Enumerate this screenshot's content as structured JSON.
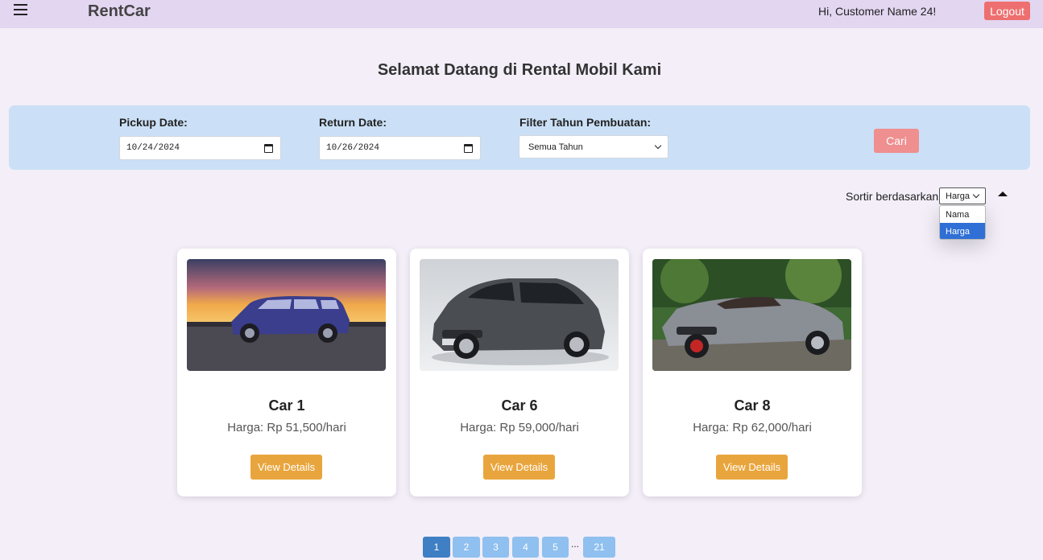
{
  "navbar": {
    "menu_icon": "hamburger-menu-icon",
    "brand": "RentCar",
    "greeting": "Hi, Customer Name 24!",
    "logout_label": "Logout"
  },
  "page_title": "Selamat Datang di Rental Mobil Kami",
  "search": {
    "pickup_label": "Pickup Date:",
    "pickup_value": "10/24/2024",
    "return_label": "Return Date:",
    "return_value": "10/26/2024",
    "year_label": "Filter Tahun Pembuatan:",
    "year_value": "Semua Tahun",
    "search_label": "Cari",
    "date_icon": "calendar-icon"
  },
  "sort": {
    "label": "Sortir berdasarkan:",
    "value": "Harga",
    "options": [
      "Nama",
      "Harga"
    ],
    "selected_option": "Harga",
    "direction_icon": "sort-ascending-icon"
  },
  "cars": [
    {
      "name": "Car 1",
      "price": "Harga: Rp 51,500/hari",
      "button": "View Details"
    },
    {
      "name": "Car 6",
      "price": "Harga: Rp 59,000/hari",
      "button": "View Details"
    },
    {
      "name": "Car 8",
      "price": "Harga: Rp 62,000/hari",
      "button": "View Details"
    }
  ],
  "pagination": {
    "pages": [
      "1",
      "2",
      "3",
      "4",
      "5"
    ],
    "ellipsis": "...",
    "last": "21",
    "current": "1"
  },
  "colors": {
    "navbar_bg": "#e3d6f1",
    "page_bg": "#f3eef8",
    "panel_bg": "#cbe0f6",
    "logout": "#ee6f6f",
    "search_button": "#ef8f8f",
    "detail_button": "#e9a53d",
    "page_active": "#3f7fc4",
    "page_inactive": "#8fc0ef",
    "dropdown_selected": "#2f6fd6"
  }
}
